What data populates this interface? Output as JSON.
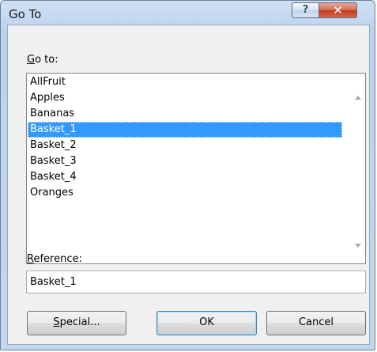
{
  "window": {
    "title": "Go To"
  },
  "titlebar": {
    "help_glyph": "?",
    "close_glyph": "✕"
  },
  "goto": {
    "label_first": "G",
    "label_rest": "o to:",
    "items": [
      "AllFruit",
      "Apples",
      "Bananas",
      "Basket_1",
      "Basket_2",
      "Basket_3",
      "Basket_4",
      "Oranges"
    ],
    "selected": "Basket_1"
  },
  "reference": {
    "label_first": "R",
    "label_rest": "eference:",
    "value": "Basket_1"
  },
  "buttons": {
    "special_first": "S",
    "special_rest": "pecial...",
    "ok": "OK",
    "cancel": "Cancel"
  },
  "colors": {
    "selection": "#3399ff",
    "close_button": "#c2391b"
  }
}
